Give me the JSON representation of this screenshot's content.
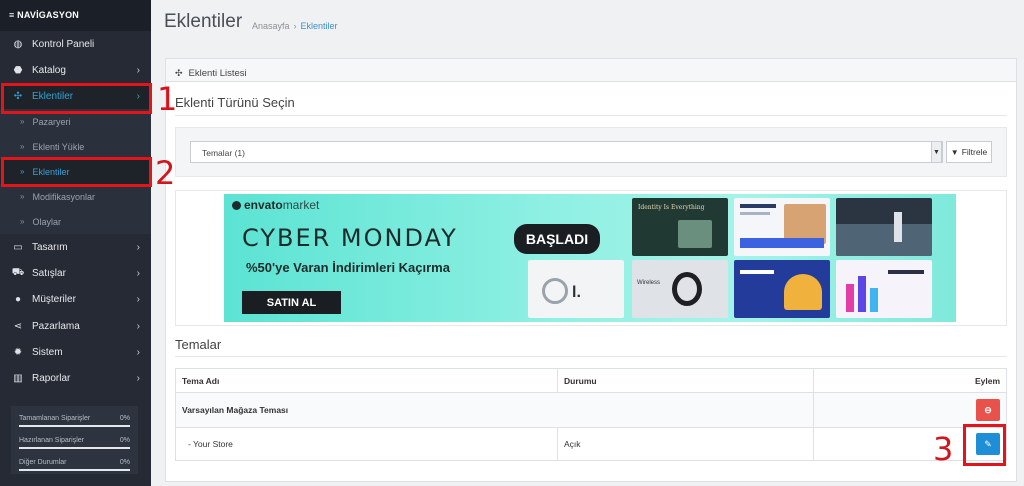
{
  "sidebar": {
    "header": "≡ NAVİGASYON",
    "items": [
      {
        "label": "Kontrol Paneli",
        "icon": "dashboard-icon",
        "glyph": "◍"
      },
      {
        "label": "Katalog",
        "icon": "tag-icon",
        "glyph": "⬣"
      },
      {
        "label": "Eklentiler",
        "icon": "puzzle-icon",
        "glyph": "✣"
      },
      {
        "label": "Tasarım",
        "icon": "monitor-icon",
        "glyph": "▭"
      },
      {
        "label": "Satışlar",
        "icon": "cart-icon",
        "glyph": "⛟"
      },
      {
        "label": "Müşteriler",
        "icon": "user-icon",
        "glyph": "●"
      },
      {
        "label": "Pazarlama",
        "icon": "share-icon",
        "glyph": "⋖"
      },
      {
        "label": "Sistem",
        "icon": "gear-icon",
        "glyph": "✹"
      },
      {
        "label": "Raporlar",
        "icon": "bar-chart-icon",
        "glyph": "▥"
      }
    ],
    "subitems": [
      "Pazaryeri",
      "Eklenti Yükle",
      "Eklentiler",
      "Modifikasyonlar",
      "Olaylar"
    ],
    "stats": [
      {
        "label": "Tamamlanan Siparişler",
        "pct": "0%"
      },
      {
        "label": "Hazırlanan Siparişler",
        "pct": "0%"
      },
      {
        "label": "Diğer Durumlar",
        "pct": "0%"
      }
    ]
  },
  "header": {
    "title": "Eklentiler",
    "breadcrumb": [
      "Anasayfa",
      "Eklentiler"
    ]
  },
  "panel": {
    "title": "Eklenti Listesi",
    "type_heading": "Eklenti Türünü Seçin",
    "select_value": "Temalar (1)",
    "filter_button": "Filtrele",
    "banner": {
      "brand": "envato",
      "brand_suffix": "market",
      "headline": "CYBER MONDAY",
      "badge": "BAŞLADI",
      "subline": "%50'ye Varan İndirimleri Kaçırma",
      "cta": "SATIN AL",
      "thumb_text": "Identity Is Everything"
    },
    "themes_heading": "Temalar",
    "table": {
      "headers": [
        "Tema Adı",
        "Durumu",
        "Eylem"
      ],
      "group_row": "Varsayılan Mağaza Teması",
      "store_row": {
        "name": "-   Your Store",
        "status": "Açık"
      }
    }
  },
  "annotations": [
    "1",
    "2",
    "3"
  ],
  "colors": {
    "accent": "#36a1d6",
    "highlight": "#e4141b",
    "danger": "#e9524a",
    "primary": "#1e8fd6"
  }
}
